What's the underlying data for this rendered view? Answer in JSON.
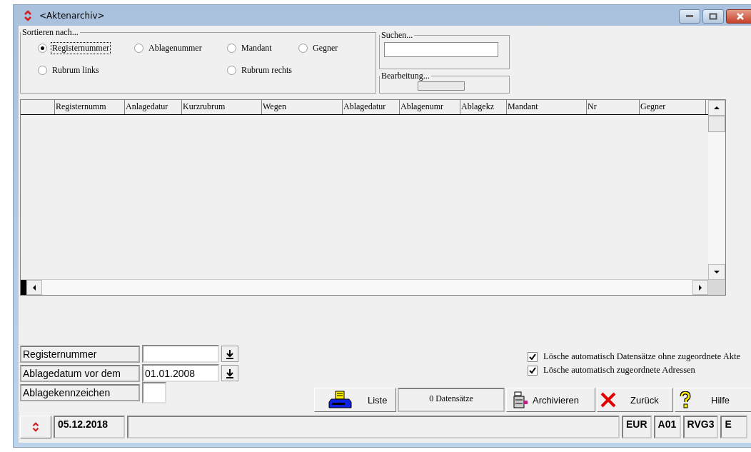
{
  "window": {
    "title": "<Aktenarchiv>"
  },
  "sort_group": {
    "title": "Sortieren nach...",
    "options": [
      {
        "label": "Registernummer",
        "selected": true
      },
      {
        "label": "Ablagenummer",
        "selected": false
      },
      {
        "label": "Mandant",
        "selected": false
      },
      {
        "label": "Gegner",
        "selected": false
      },
      {
        "label": "Rubrum links",
        "selected": false
      },
      {
        "label": "Rubrum rechts",
        "selected": false
      }
    ]
  },
  "search_group": {
    "title": "Suchen..."
  },
  "edit_group": {
    "title": "Bearbeitung..."
  },
  "table": {
    "columns": [
      "",
      "Registernumm",
      "Anlagedatur",
      "Kurzrubrum",
      "Wegen",
      "Ablagedatur",
      "Ablagenumr",
      "Ablagekz",
      "Mandant",
      "Nr",
      "Gegner"
    ]
  },
  "filters": [
    {
      "label": "Registernummer",
      "kind": "picker"
    },
    {
      "label": "Ablagedatum vor dem",
      "value": "01.01.2008",
      "kind": "picker"
    },
    {
      "label": "Ablagekennzeichen",
      "kind": "short"
    }
  ],
  "options": [
    {
      "label": "Lösche automatisch Datensätze ohne zugeordnete Akte",
      "checked": true
    },
    {
      "label": "Lösche automatisch zugeordnete Adressen",
      "checked": true
    }
  ],
  "toolbar": {
    "list_button": "Liste",
    "record_count": "0 Datensätze",
    "archive_button": "Archivieren",
    "back_button": "Zurück",
    "help_button": "Hilfe"
  },
  "status_bar": {
    "date": "05.12.2018",
    "fields": [
      "EUR",
      "A01",
      "RVG3",
      "E"
    ]
  }
}
